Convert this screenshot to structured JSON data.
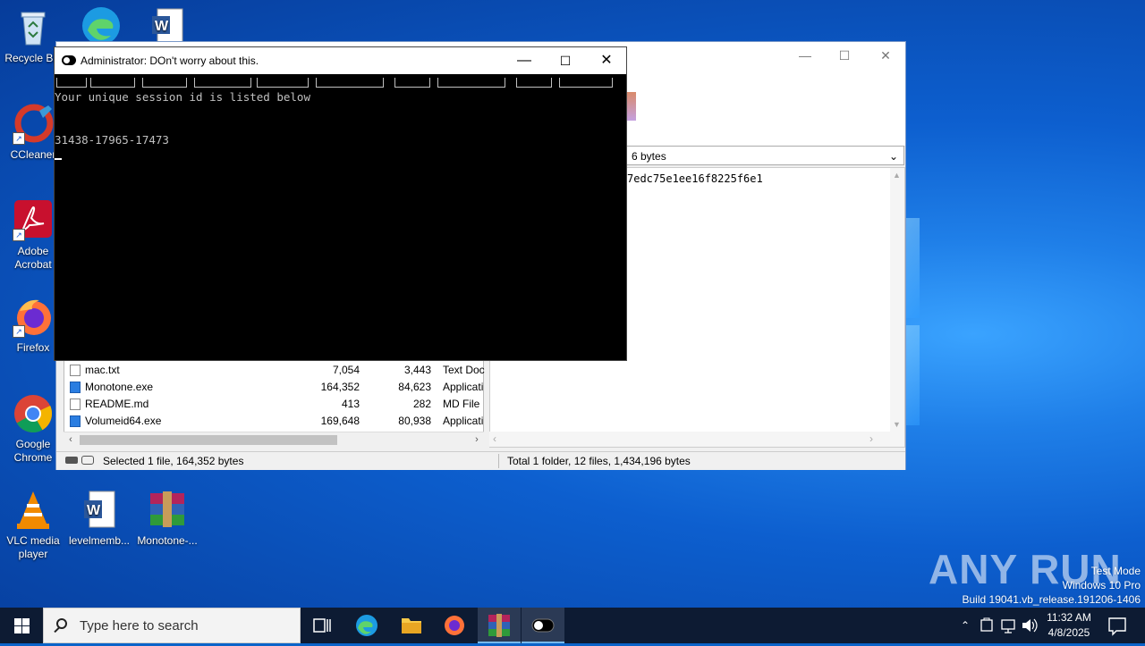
{
  "desktop": {
    "icons": [
      {
        "label": "Recycle Bin"
      },
      {
        "label": "CCleaner"
      },
      {
        "label": "Adobe Acrobat"
      },
      {
        "label": "Firefox"
      },
      {
        "label": "Google Chrome"
      },
      {
        "label": "VLC media player"
      },
      {
        "label": "levelmemb..."
      },
      {
        "label": "Monotone-..."
      }
    ]
  },
  "console": {
    "title": "Administrator:  DOn't worry about this.",
    "line1": "Your unique session id is listed below",
    "session_id": "31438-17965-17473",
    "controls": {
      "minimize": "—",
      "maximize": "☐",
      "close": "✕"
    }
  },
  "archive_window": {
    "info_combo": "6 bytes",
    "hash": "7edc75e1ee16f8225f6e1",
    "files": [
      {
        "name": "mac.txt",
        "size": "7,054",
        "packed": "3,443",
        "type": "Text Doc",
        "kind": "txt"
      },
      {
        "name": "Monotone.exe",
        "size": "164,352",
        "packed": "84,623",
        "type": "Applicati",
        "kind": "exe"
      },
      {
        "name": "README.md",
        "size": "413",
        "packed": "282",
        "type": "MD File",
        "kind": "txt"
      },
      {
        "name": "Volumeid64.exe",
        "size": "169,648",
        "packed": "80,938",
        "type": "Applicati",
        "kind": "exe"
      }
    ],
    "status_left": "Selected 1 file, 164,352 bytes",
    "status_right": "Total 1 folder, 12 files, 1,434,196 bytes"
  },
  "watermark": {
    "brand": "ANY RUN",
    "line1": "Test Mode",
    "line2": "Windows 10 Pro",
    "line3": "Build 19041.vb_release.191206-1406"
  },
  "taskbar": {
    "search_placeholder": "Type here to search",
    "time": "11:32 AM",
    "date": "4/8/2025"
  }
}
